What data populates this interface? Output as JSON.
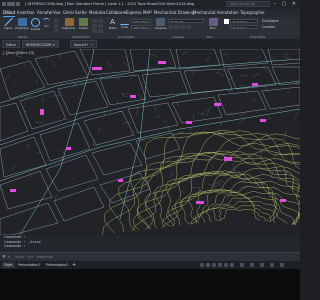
{
  "titlebar": {
    "title": "[ INTERSECCION.dwg ] Mon Standard Frame | Code 1.1 - 2012 Topo Rhea2016 Marin2016.dwg",
    "search_placeholder": "Tapez un mot-clé",
    "window_buttons": "– ▢ ✕"
  },
  "menubar": {
    "items": [
      "Début",
      "Insertion",
      "Annoter",
      "Vue",
      "Gérer",
      "Sortie",
      "Modules",
      "Collaborer",
      "Express",
      "MAP",
      "Mechanical Drawing",
      "Mechanical Annotation",
      "Topographie"
    ]
  },
  "ribbon": {
    "buttons": [
      "Ligne",
      "Polyligne",
      "Cercle",
      "Arc",
      "Déplacer",
      "Copier",
      "Texte",
      "Cote",
      "Calques",
      "Bloc"
    ],
    "panels": [
      "Dessin",
      "Modification",
      "Annotation",
      "Calques",
      "Bloc",
      "Propriétés"
    ],
    "layer_dropdown": "Calque0",
    "style_dropdown": "Standard",
    "color_dropdown": "DuCalque",
    "linetype_dropdown": "DuCalque",
    "props": [
      "DuCalque",
      "Continu"
    ]
  },
  "doctabs": {
    "tabs": [
      "Début",
      "INTERSECCION*",
      "Dessin1*"
    ]
  },
  "viewport": {
    "label": "[-][Haut][Filaire 2D]"
  },
  "command": {
    "history": [
      "Commande :",
      "Commande : _erase",
      "Commande :"
    ],
    "placeholder": "Tapez une commande"
  },
  "status": {
    "tabs": [
      "Objet",
      "Présentation1",
      "Présentation2"
    ]
  },
  "colors": {
    "topo_lines": "#d6e07a",
    "street_blocks": "#b6c7e0",
    "labels": "#e04ce0",
    "roads": "#7dd2e0"
  }
}
